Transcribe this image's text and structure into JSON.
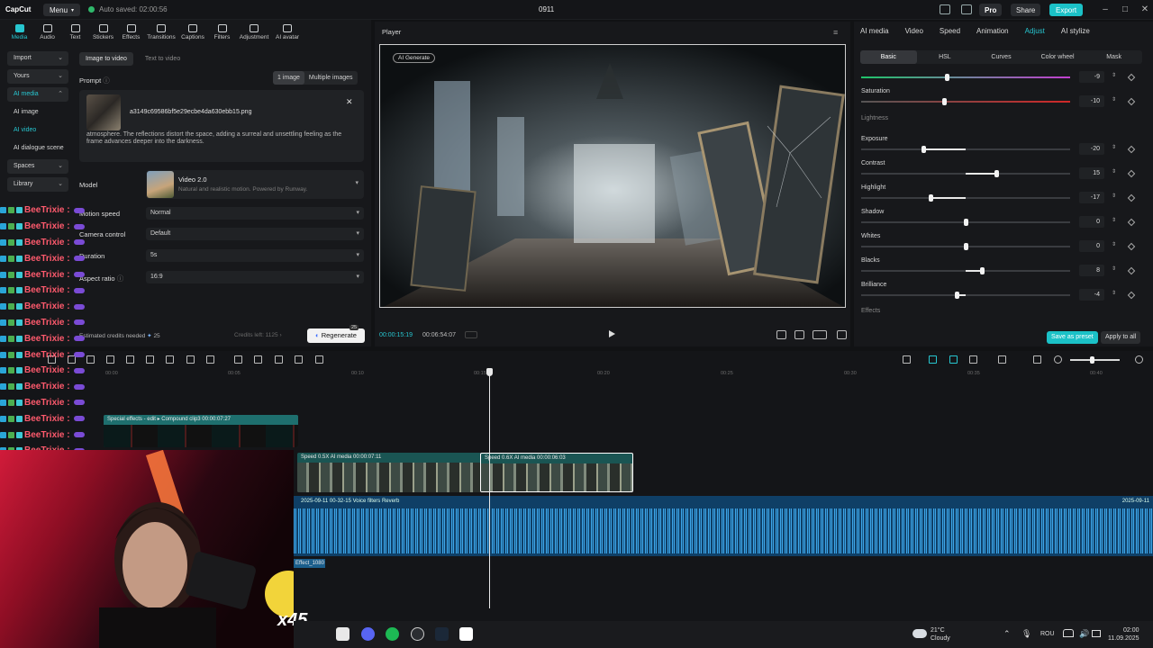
{
  "titlebar": {
    "logo": "CapCut",
    "menu_label": "Menu",
    "autosave": "Auto saved: 02:00:56",
    "project_title": "0911",
    "pro_label": "Pro",
    "share_label": "Share",
    "export_label": "Export"
  },
  "toolbar_tabs": [
    "Media",
    "Audio",
    "Text",
    "Stickers",
    "Effects",
    "Transitions",
    "Captions",
    "Filters",
    "Adjustment",
    "AI avatar"
  ],
  "sidebar": {
    "items": [
      "Import",
      "Yours",
      "AI media",
      "AI image",
      "AI video",
      "AI dialogue scene",
      "Spaces",
      "Library"
    ]
  },
  "left": {
    "mode_tabs": [
      "Image to video",
      "Text to video"
    ],
    "prompt_label": "Prompt",
    "image_count_tabs": [
      "1 image",
      "Multiple images"
    ],
    "file_name": "a3149c69586bf5e29ecbe4da630ebb15.png",
    "prompt_text": "atmosphere. The reflections distort the space, adding a surreal and unsettling feeling as the frame advances deeper into the darkness.",
    "model_label": "Model",
    "model_name": "Video 2.0",
    "model_desc": "Natural and realistic motion. Powered by Runway.",
    "motion_speed_label": "Motion speed",
    "motion_speed_value": "Normal",
    "camera_control_label": "Camera control",
    "camera_control_value": "Default",
    "duration_label": "Duration",
    "duration_value": "5s",
    "aspect_label": "Aspect ratio",
    "aspect_value": "16:9",
    "credits_text": "Estimated credits needed",
    "credits_value": "25",
    "credits_left": "Credits left: 1125",
    "regenerate_label": "Regenerate",
    "regenerate_badge": "25"
  },
  "chat": {
    "username": "BeeTrixie :",
    "rows": 16
  },
  "player": {
    "title": "Player",
    "ai_badge": "AI Generate",
    "time_current": "00:00:15:19",
    "time_total": "00:06:54:07"
  },
  "right": {
    "tabs": [
      "AI media",
      "Video",
      "Speed",
      "Animation",
      "Adjust",
      "AI stylize"
    ],
    "sub_tabs": [
      "Basic",
      "HSL",
      "Curves",
      "Color wheel",
      "Mask"
    ],
    "sliders": [
      {
        "label": "",
        "value": "-9",
        "level": -9
      },
      {
        "label": "Saturation",
        "value": "-10",
        "level": -10
      },
      {
        "label": "Exposure",
        "value": "-20",
        "level": -20
      },
      {
        "label": "Contrast",
        "value": "15",
        "level": 15
      },
      {
        "label": "Highlight",
        "value": "-17",
        "level": -17
      },
      {
        "label": "Shadow",
        "value": "0",
        "level": 0
      },
      {
        "label": "Whites",
        "value": "0",
        "level": 0
      },
      {
        "label": "Blacks",
        "value": "8",
        "level": 8
      },
      {
        "label": "Brilliance",
        "value": "-4",
        "level": -4
      }
    ],
    "group_lightness": "Lightness",
    "group_effects": "Effects",
    "save_preset": "Save as preset",
    "apply_all": "Apply to all"
  },
  "timeline": {
    "ruler_ticks": [
      "00:00",
      "00:05",
      "00:10",
      "00:15",
      "00:20",
      "00:25",
      "00:30",
      "00:35",
      "00:40"
    ],
    "fx_clip_label": "Special effects - edit ▸  Compound clip3  00:00:07:27",
    "clip1_label": "Speed 0.5X   AI media  00:00:07:11",
    "clip2_label": "Speed 0.6X   AI media  00:00:06:03",
    "audio_label": "2025-09-11 00-32-15   Voice filters Reverb",
    "audio_label_right": "2025-09-11",
    "effect_label": "Effect_1080"
  },
  "stream": {
    "sticker_label": "x45"
  },
  "taskbar": {
    "temp": "21°C",
    "weather": "Cloudy",
    "lang": "ROU",
    "time": "02:00",
    "date": "11.09.2025"
  }
}
